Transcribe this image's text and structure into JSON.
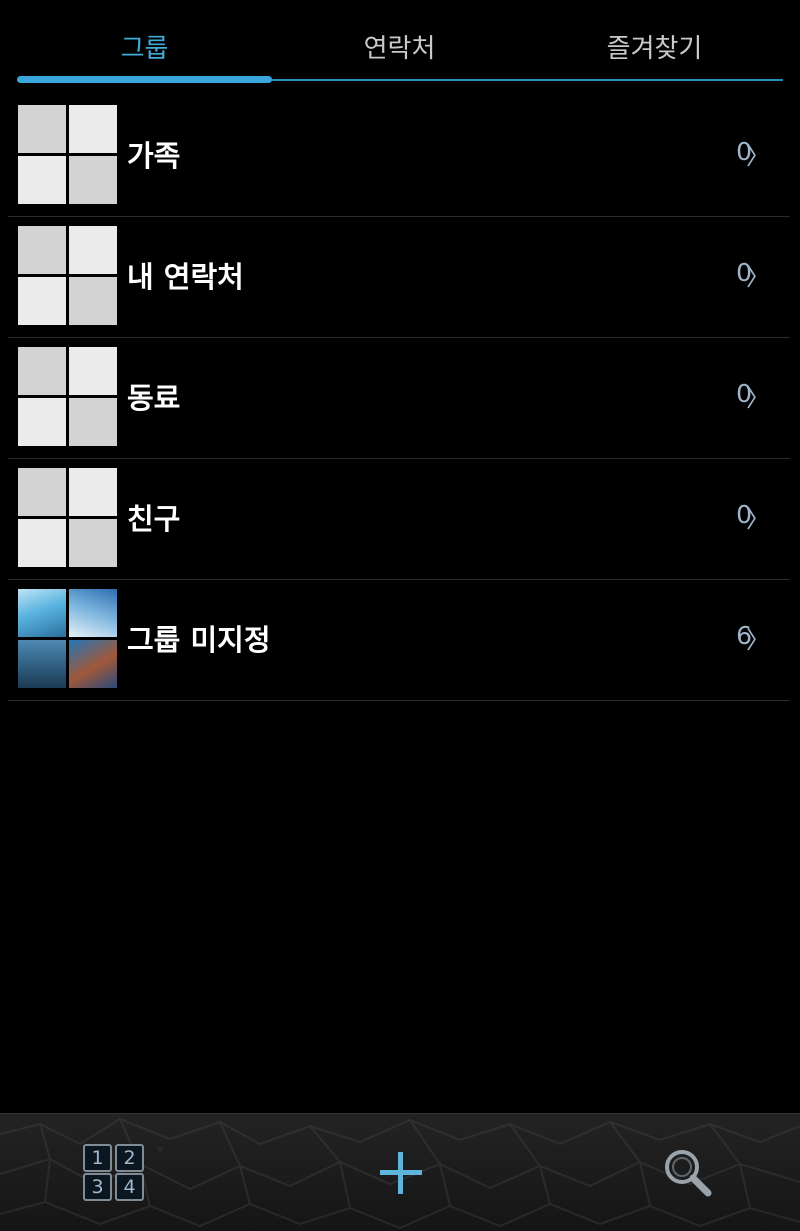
{
  "tabs": [
    {
      "label": "그룹",
      "active": true
    },
    {
      "label": "연락처",
      "active": false
    },
    {
      "label": "즐겨찾기",
      "active": false
    }
  ],
  "groups": [
    {
      "name": "가족",
      "count": "0",
      "thumb": "placeholder"
    },
    {
      "name": "내 연락처",
      "count": "0",
      "thumb": "placeholder"
    },
    {
      "name": "동료",
      "count": "0",
      "thumb": "placeholder"
    },
    {
      "name": "친구",
      "count": "0",
      "thumb": "placeholder"
    },
    {
      "name": "그룹 미지정",
      "count": "6",
      "thumb": "photos"
    }
  ],
  "chevron": "〉",
  "bottom_bar": {
    "dialpad_keys": [
      "1",
      "2",
      "3",
      "4"
    ],
    "add_icon": "plus-icon",
    "search_icon": "search-icon"
  },
  "colors": {
    "accent": "#3aa7dc",
    "background": "#000000",
    "count_text": "#9fb3c9"
  }
}
